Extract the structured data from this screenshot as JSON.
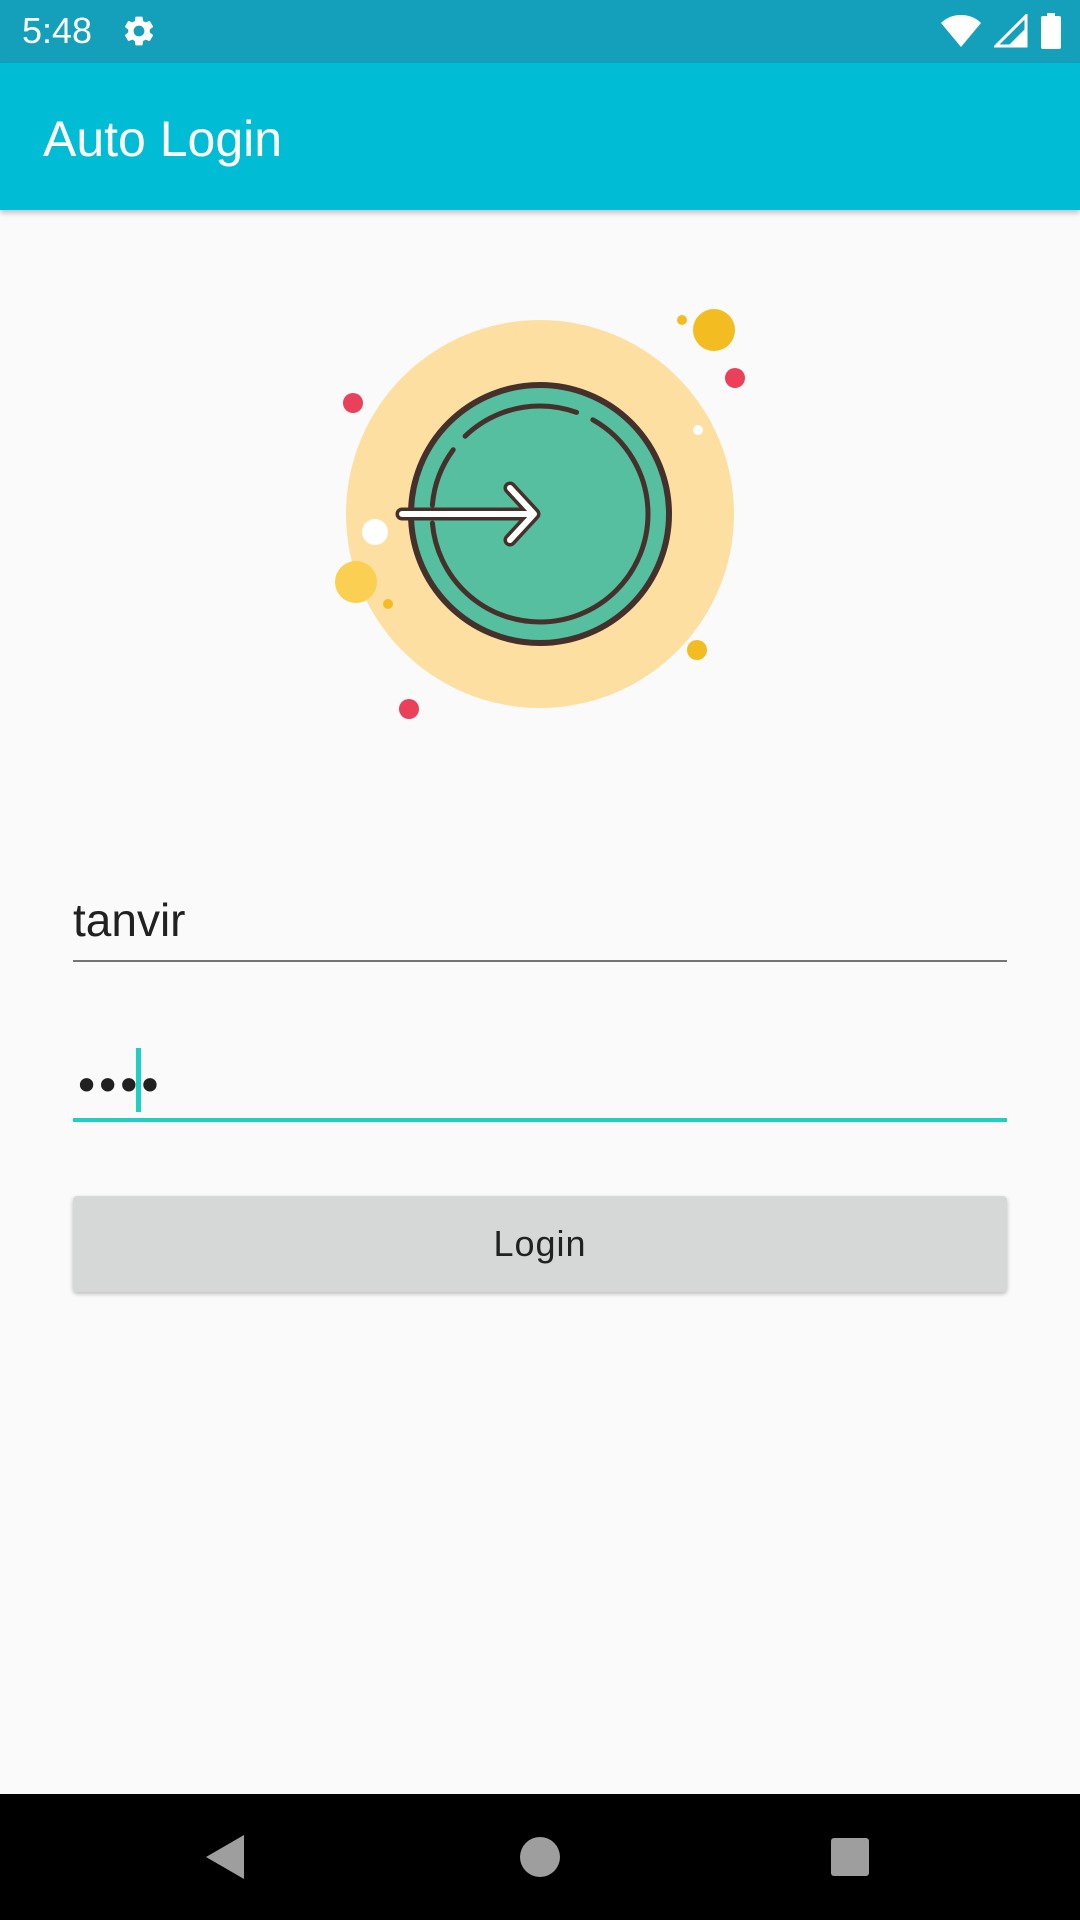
{
  "status_bar": {
    "time": "5:48",
    "icons": [
      "settings-gear-icon",
      "wifi-icon",
      "cellular-signal-icon",
      "battery-icon"
    ]
  },
  "app_bar": {
    "title": "Auto Login",
    "color": "#00bcd4"
  },
  "illustration": {
    "icon": "login-arrow-icon"
  },
  "form": {
    "username": {
      "value": "tanvir"
    },
    "password": {
      "masked_value": "••••",
      "focused": true
    },
    "login_button_label": "Login"
  },
  "nav_bar": {
    "icons": [
      "back-icon",
      "home-icon",
      "recents-icon"
    ]
  },
  "colors": {
    "status_bar": "#14a0bb",
    "accent": "#1ecfc4",
    "button": "#d6d7d7"
  }
}
